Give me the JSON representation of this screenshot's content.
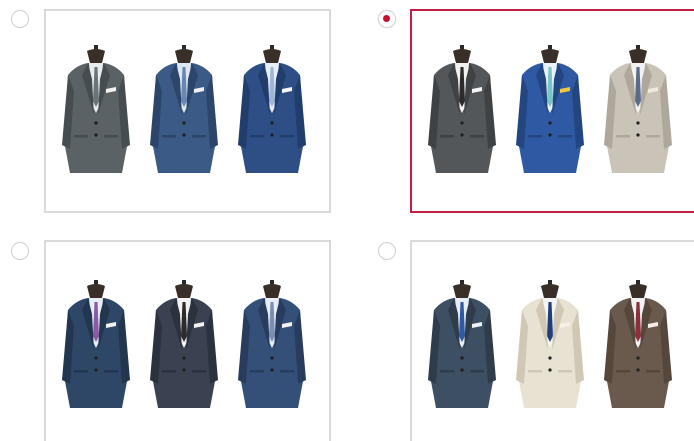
{
  "selection": {
    "question": "",
    "selected_index": 1
  },
  "colors": {
    "accent": "#c21f45",
    "radio_dot": "#c8102e",
    "card_border": "#d9d9d9"
  },
  "options": [
    {
      "id": "option-1",
      "selected": false,
      "jackets": [
        {
          "body": "#5b6266",
          "shade": "#464d51",
          "shirt": "#e8ecef",
          "tie": "#6a747a",
          "pocket": "#f2f2f2"
        },
        {
          "body": "#3b5a86",
          "shade": "#2c466b",
          "shirt": "#dfe8f2",
          "tie": "#6a86b3",
          "pocket": "#eef2f7"
        },
        {
          "body": "#2d4f86",
          "shade": "#213d6b",
          "shirt": "#e6eef7",
          "tie": "#9fb6d6",
          "pocket": "#f4f6f9"
        }
      ]
    },
    {
      "id": "option-2",
      "selected": true,
      "jackets": [
        {
          "body": "#54575a",
          "shade": "#3f4244",
          "shirt": "#f1f1f1",
          "tie": "#2c2c2c",
          "pocket": "#f5f5f5"
        },
        {
          "body": "#2f5aa3",
          "shade": "#244680",
          "shirt": "#eaf0f7",
          "tie": "#79c5c5",
          "pocket": "#f0c742"
        },
        {
          "body": "#c9c3b8",
          "shade": "#aea79b",
          "shirt": "#f2f2f2",
          "tie": "#5b6a88",
          "pocket": "#efe9df"
        }
      ]
    },
    {
      "id": "option-3",
      "selected": false,
      "jackets": [
        {
          "body": "#2f4766",
          "shade": "#22364f",
          "shirt": "#e8edf4",
          "tie": "#8b5aa6",
          "pocket": "#f2f2f2"
        },
        {
          "body": "#3a4150",
          "shade": "#2b313d",
          "shirt": "#f2f2f2",
          "tie": "#2b2b2b",
          "pocket": "#f2f2f2"
        },
        {
          "body": "#355078",
          "shade": "#283d5d",
          "shirt": "#e6edf6",
          "tie": "#7b8eb3",
          "pocket": "#f2f2f2"
        }
      ]
    },
    {
      "id": "option-4",
      "selected": false,
      "jackets": [
        {
          "body": "#3d4f62",
          "shade": "#2e3c4b",
          "shirt": "#e6edf4",
          "tie": "#2f5aa3",
          "pocket": "#eef2f7"
        },
        {
          "body": "#e8e2d2",
          "shade": "#d0c8b4",
          "shirt": "#f4f4f4",
          "tie": "#1f3f7a",
          "pocket": "#f5f1e7"
        },
        {
          "body": "#6a5a4d",
          "shade": "#55473c",
          "shirt": "#f2f2f2",
          "tie": "#8c2f3c",
          "pocket": "#f3efe8"
        }
      ]
    }
  ]
}
